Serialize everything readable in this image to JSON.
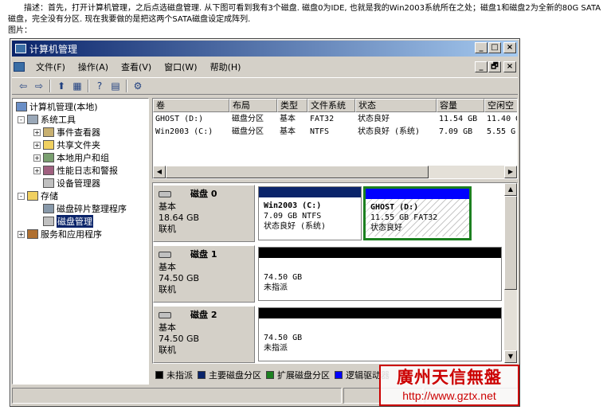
{
  "description": {
    "text": "描述：首先，打开计算机管理，之后点选磁盘管理. 从下图可看到我有3个磁盘. 磁盘0为IDE, 也就是我的Win2003系统所在之处；磁盘1和磁盘2为全新的80G SATA磁盘，完全没有分区. 现在我要做的是把这两个SATA磁盘设定成阵列.",
    "image_label": "图片："
  },
  "window": {
    "title": "计算机管理",
    "buttons": {
      "minimize": "_",
      "maximize": "□",
      "close": "×",
      "restore": "🗗"
    }
  },
  "menu": [
    "文件(F)",
    "操作(A)",
    "查看(V)",
    "窗口(W)",
    "帮助(H)"
  ],
  "toolbar": [
    "⇦",
    "⇨",
    "⬆",
    "▦",
    "?",
    "▤",
    "⚙"
  ],
  "tree": [
    {
      "label": "计算机管理(本地)",
      "icon": "computer-icon"
    },
    {
      "label": "系统工具",
      "icon": "tools-icon"
    },
    {
      "label": "事件查看器",
      "icon": "event-viewer-icon"
    },
    {
      "label": "共享文件夹",
      "icon": "shared-folder-icon"
    },
    {
      "label": "本地用户和组",
      "icon": "users-icon"
    },
    {
      "label": "性能日志和警报",
      "icon": "performance-icon"
    },
    {
      "label": "设备管理器",
      "icon": "device-manager-icon"
    },
    {
      "label": "存储",
      "icon": "storage-icon"
    },
    {
      "label": "磁盘碎片整理程序",
      "icon": "defrag-icon"
    },
    {
      "label": "磁盘管理",
      "icon": "disk-management-icon"
    },
    {
      "label": "服务和应用程序",
      "icon": "services-icon"
    }
  ],
  "tree_toggles": {
    "expanded": "-",
    "collapsed": "+"
  },
  "volume_table": {
    "columns": [
      "卷",
      "布局",
      "类型",
      "文件系统",
      "状态",
      "容量",
      "空闲空"
    ],
    "rows": [
      [
        "GHOST (D:)",
        "磁盘分区",
        "基本",
        "FAT32",
        "状态良好",
        "11.54 GB",
        "11.40 G"
      ],
      [
        "Win2003 (C:)",
        "磁盘分区",
        "基本",
        "NTFS",
        "状态良好 (系统)",
        "7.09 GB",
        "5.55 G"
      ]
    ]
  },
  "disks": [
    {
      "name": "磁盘 0",
      "type": "基本",
      "size": "18.64 GB",
      "status": "联机",
      "volumes": [
        {
          "name": "Win2003  (C:)",
          "detail": "7.09 GB NTFS",
          "status": "状态良好 (系统)"
        },
        {
          "name": "GHOST  (D:)",
          "detail": "11.55 GB FAT32",
          "status": "状态良好"
        }
      ]
    },
    {
      "name": "磁盘 1",
      "type": "基本",
      "size": "74.50 GB",
      "status": "联机",
      "volumes": [
        {
          "name": "",
          "detail": "74.50 GB",
          "status": "未指派"
        }
      ]
    },
    {
      "name": "磁盘 2",
      "type": "基本",
      "size": "74.50 GB",
      "status": "联机",
      "volumes": [
        {
          "name": "",
          "detail": "74.50 GB",
          "status": "未指派"
        }
      ]
    }
  ],
  "legend": [
    {
      "label": "未指派",
      "color": "#000000"
    },
    {
      "label": "主要磁盘分区",
      "color": "#0a246a"
    },
    {
      "label": "扩展磁盘分区",
      "color": "#1c8020"
    },
    {
      "label": "逻辑驱动器",
      "color": "#0000ff"
    }
  ],
  "scroll_arrows": {
    "left": "◀",
    "right": "▶",
    "up": "▲",
    "down": "▼"
  },
  "watermark": {
    "line1": "廣州天信無盤",
    "line2": "http://www.gztx.net"
  },
  "colors": {
    "titlebar": "#0a246a",
    "primary_partition": "#0a246a",
    "unallocated": "#000000",
    "selection": "#1c8020"
  }
}
